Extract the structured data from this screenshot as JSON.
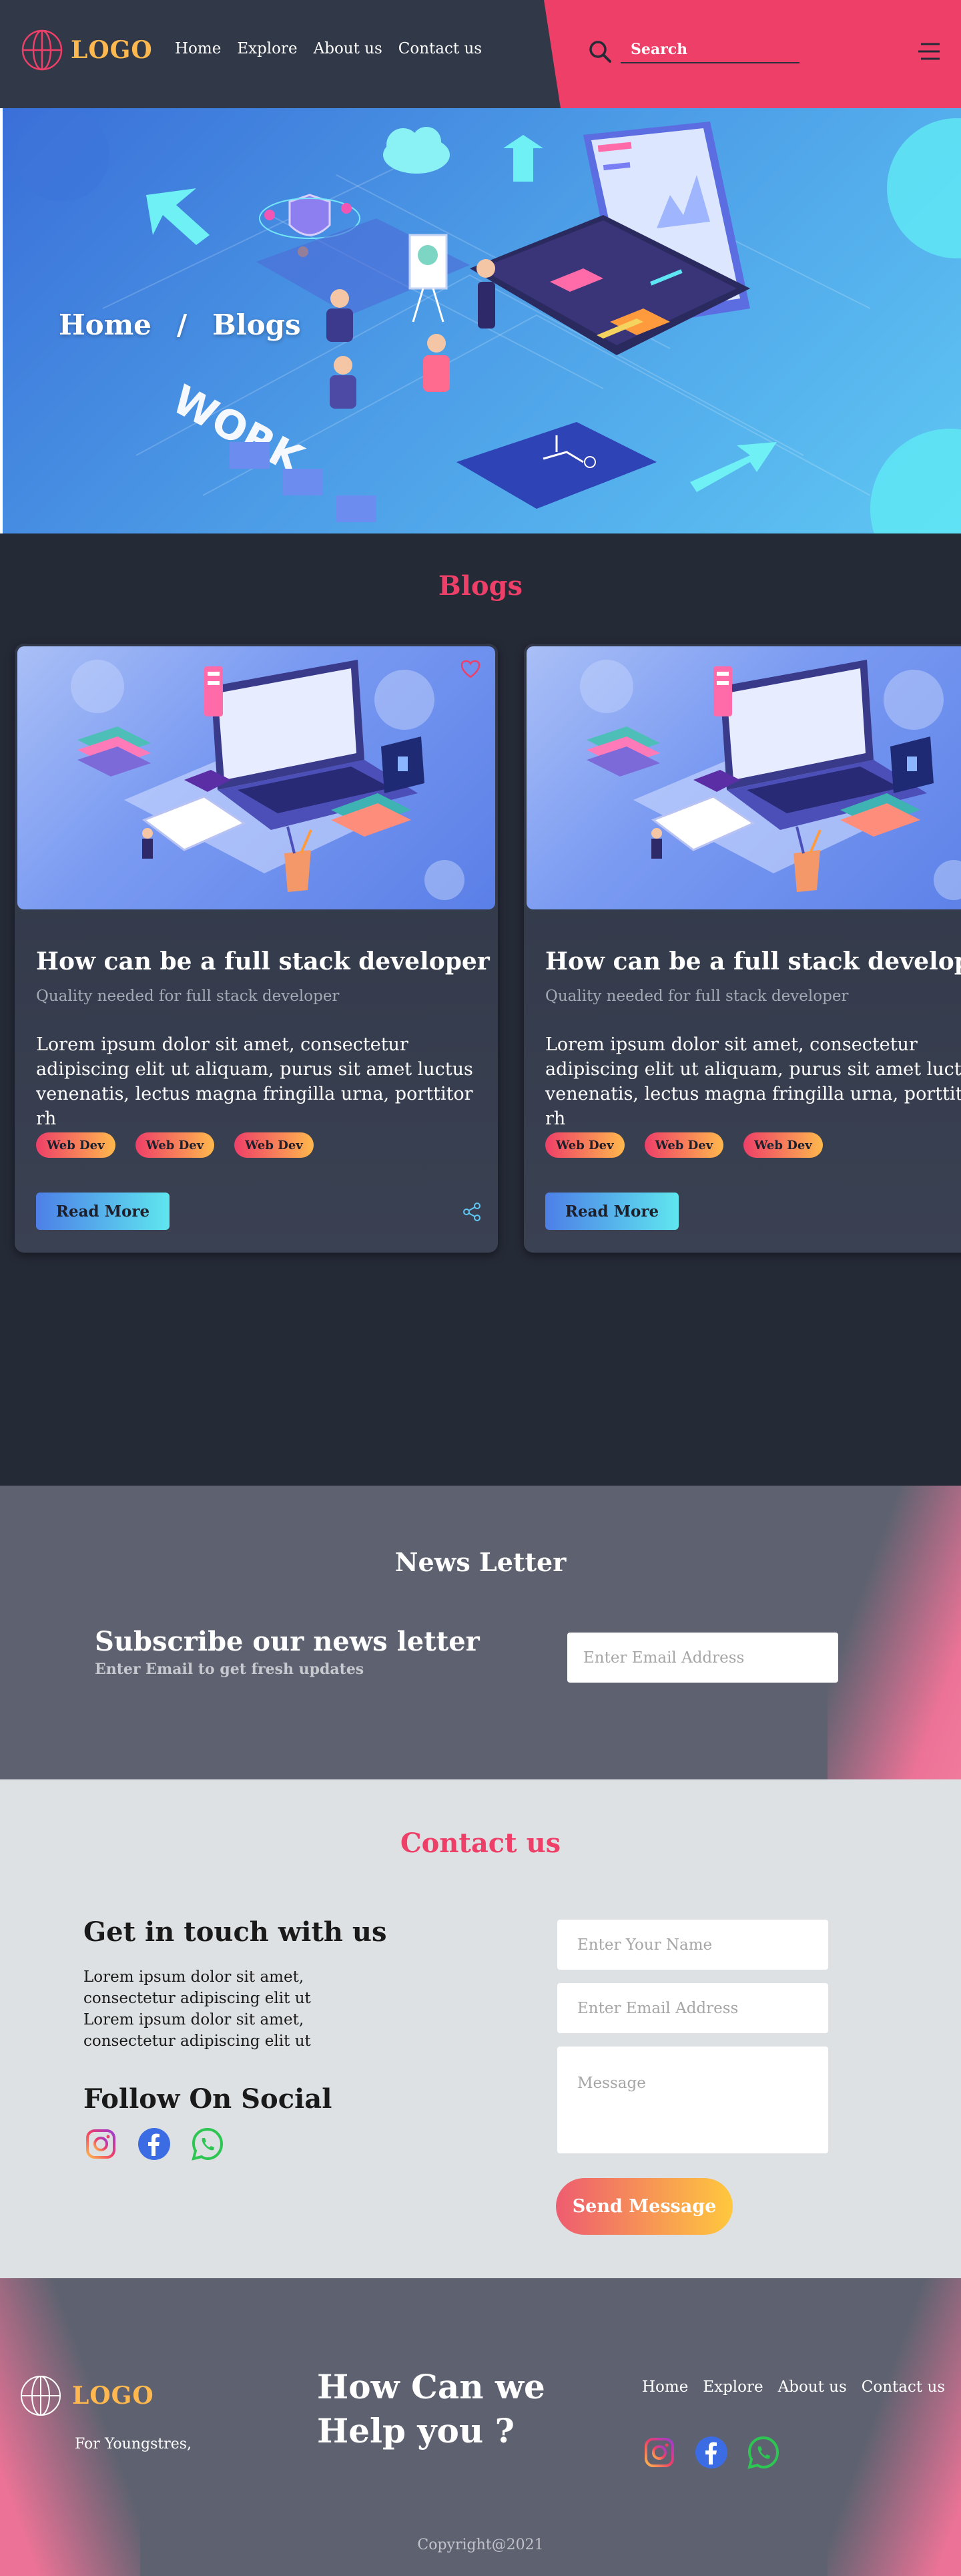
{
  "header": {
    "logo_text": "LOGO",
    "nav": [
      "Home",
      "Explore",
      "About us",
      "Contact us"
    ],
    "search_placeholder": "Search"
  },
  "hero": {
    "breadcrumb_home": "Home",
    "breadcrumb_sep": "/",
    "breadcrumb_current": "Blogs",
    "art_word": "WORK"
  },
  "blogs": {
    "title": "Blogs",
    "cards": [
      {
        "title": "How can be a full stack developer",
        "subtitle": "Quality needed for full stack developer",
        "body": "Lorem ipsum dolor sit amet, consectetur adipiscing elit ut aliquam, purus sit amet luctus venenatis, lectus magna fringilla urna, porttitor rh",
        "tags": [
          "Web Dev",
          "Web Dev",
          "Web Dev"
        ],
        "button": "Read More"
      },
      {
        "title": "How can be a full stack developer",
        "subtitle": "Quality needed for full stack developer",
        "body": "Lorem ipsum dolor sit amet, consectetur adipiscing elit ut aliquam, purus sit amet luctus venenatis, lectus magna fringilla urna, porttitor rh",
        "tags": [
          "Web Dev",
          "Web Dev",
          "Web Dev"
        ],
        "button": "Read More"
      }
    ]
  },
  "newsletter": {
    "title": "News Letter",
    "heading": "Subscribe our news letter",
    "sub": "Enter Email to get fresh updates",
    "email_placeholder": "Enter Email Address"
  },
  "contact": {
    "title": "Contact us",
    "heading": "Get in touch with us",
    "body": "Lorem ipsum dolor sit amet, consectetur adipiscing elit ut Lorem ipsum dolor sit amet, consectetur adipiscing elit ut",
    "follow": "Follow On Social",
    "name_placeholder": "Enter Your Name",
    "email_placeholder": "Enter Email Address",
    "message_placeholder": "Message",
    "send": "Send Message"
  },
  "footer": {
    "logo_text": "LOGO",
    "tagline": "For Youngstres,",
    "help_line1": "How Can we",
    "help_line2": "Help you ?",
    "nav": [
      "Home",
      "Explore",
      "About us",
      "Contact us"
    ],
    "copyright": "Copyright@2021"
  },
  "colors": {
    "accent_pink": "#ee3f68",
    "accent_orange": "#ffb84d",
    "dark_bg": "#252a37",
    "header_bg": "#313847",
    "panel_gray": "#5e6270",
    "light_bg": "#dde1e3"
  },
  "icons": {
    "logo": "globe-icon",
    "search": "search-icon",
    "menu": "menu-icon",
    "favorite": "heart-icon",
    "share": "share-icon",
    "socials": [
      "instagram-icon",
      "facebook-icon",
      "whatsapp-icon"
    ]
  }
}
